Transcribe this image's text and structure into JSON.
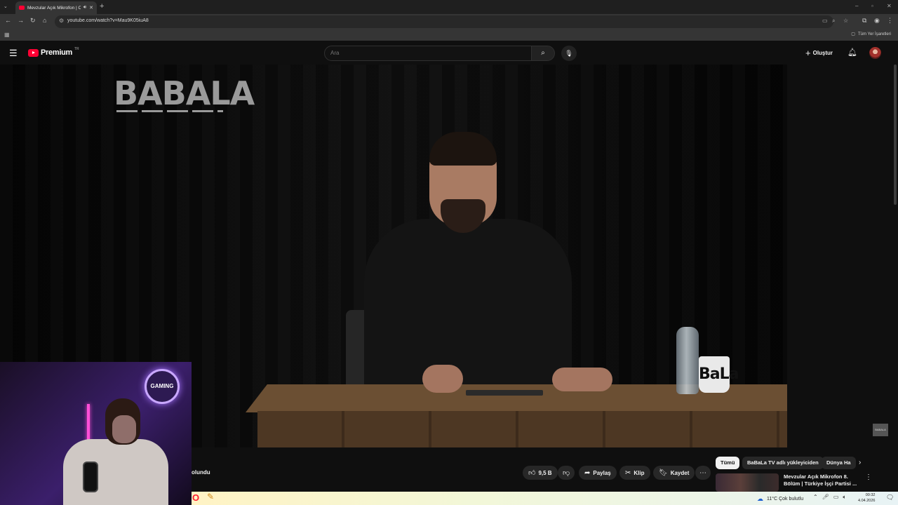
{
  "browser": {
    "tab_title": "Mevzular Açık Mikrofon | C",
    "url": "youtube.com/watch?v=Mau9K05iuA8",
    "bookmarks_folder": "Tüm Yer İşaretleri"
  },
  "masthead": {
    "logo_text": "Premium",
    "logo_country": "TR",
    "search_placeholder": "Ara",
    "create_label": "Oluştur"
  },
  "player": {
    "watermark": "BABALA",
    "mug_text": "BaLa",
    "side_thumb": "BABALA",
    "webcam_sign": "GAMING"
  },
  "actions": {
    "subscribe_fragment": "olundu",
    "like_count": "9,5 B",
    "share_label": "Paylaş",
    "clip_label": "Klip",
    "save_label": "Kaydet"
  },
  "chips": [
    "Tümü",
    "BaBaLa TV adlı yükleyiciden",
    "Dünya Ha"
  ],
  "recommendation": {
    "title": "Mevzular Açık Mikrofon 8. Bölüm | Türkiye İşçi Partisi ..."
  },
  "taskbar": {
    "weather": "11°C  Çok bulutlu",
    "time": "00:32",
    "date": "4.04.2026"
  }
}
